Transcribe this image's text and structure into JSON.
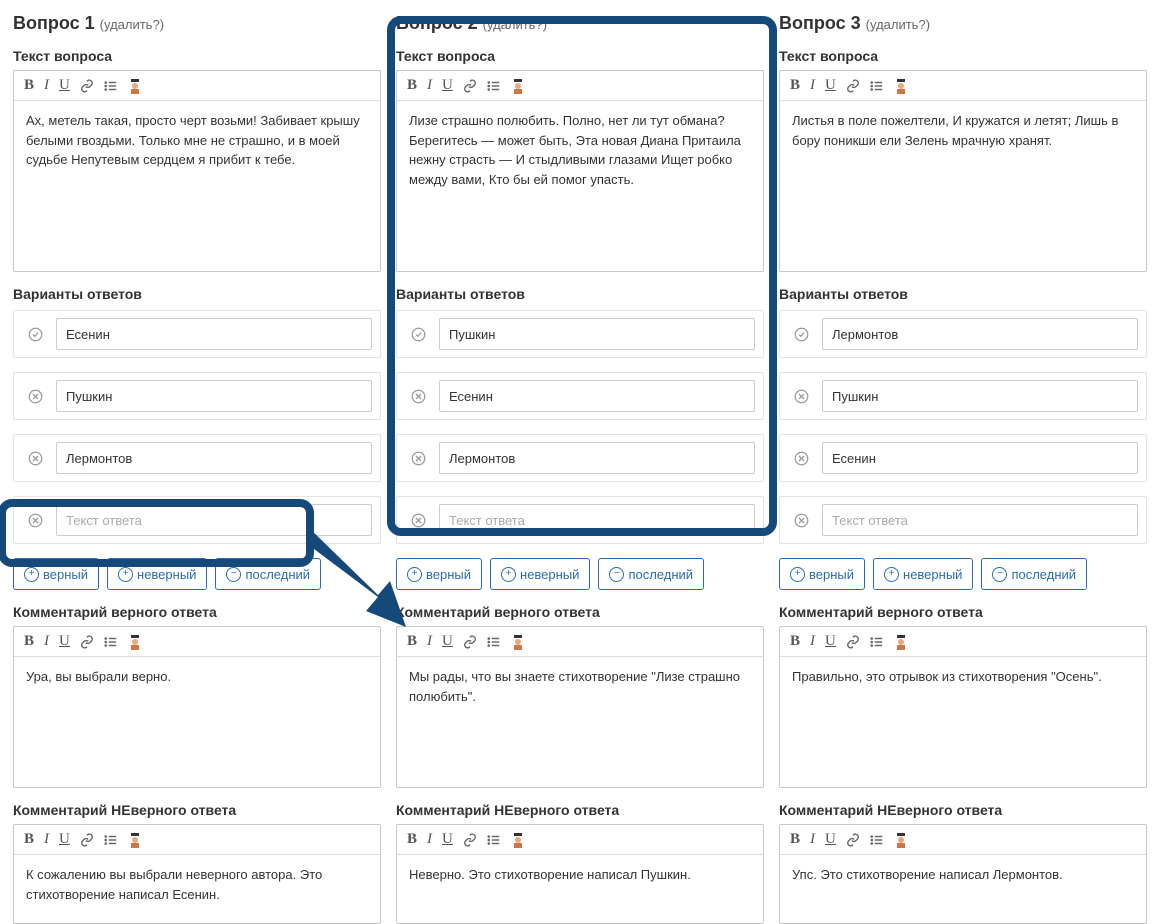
{
  "labels": {
    "delete": "(удалить?)",
    "question_text": "Текст вопроса",
    "answer_variants": "Варианты ответов",
    "answer_placeholder": "Текст ответа",
    "btn_correct": "верный",
    "btn_incorrect": "неверный",
    "btn_last": "последний",
    "comment_correct": "Комментарий верного ответа",
    "comment_incorrect": "Комментарий НЕверного ответа"
  },
  "toolbar": {
    "bold": "B",
    "italic": "I",
    "underline": "U",
    "link": "link",
    "list": "list",
    "avatar": "avatar"
  },
  "questions": [
    {
      "title": "Вопрос 1",
      "body": "Ах, метель такая, просто черт возьми! Забивает крышу белыми гвоздьми. Только мне не страшно, и в моей судьбе Непутевым сердцем я прибит к тебе.",
      "answers": [
        {
          "correct": true,
          "text": "Есенин"
        },
        {
          "correct": false,
          "text": "Пушкин"
        },
        {
          "correct": false,
          "text": "Лермонтов"
        },
        {
          "correct": false,
          "text": ""
        }
      ],
      "comment_correct": "Ура, вы выбрали верно.",
      "comment_incorrect": "К сожалению вы выбрали неверного автора. Это стихотворение написал Есенин."
    },
    {
      "title": "Вопрос 2",
      "body": "Лизе страшно полюбить. Полно, нет ли тут обмана? Берегитесь — может быть, Эта новая Диана Притаила нежну страсть — И стыдливыми глазами Ищет робко между вами, Кто бы ей помог упасть.",
      "answers": [
        {
          "correct": true,
          "text": "Пушкин"
        },
        {
          "correct": false,
          "text": "Есенин"
        },
        {
          "correct": false,
          "text": "Лермонтов"
        },
        {
          "correct": false,
          "text": ""
        }
      ],
      "comment_correct": "Мы рады, что вы знаете стихотворение \"Лизе страшно полюбить\".",
      "comment_incorrect": "Неверно. Это стихотворение написал Пушкин."
    },
    {
      "title": "Вопрос 3",
      "body": "Листья в поле пожелтели, И кружатся и летят; Лишь в бору поникши ели Зелень мрачную хранят.",
      "answers": [
        {
          "correct": true,
          "text": "Лермонтов"
        },
        {
          "correct": false,
          "text": "Пушкин"
        },
        {
          "correct": false,
          "text": "Есенин"
        },
        {
          "correct": false,
          "text": ""
        }
      ],
      "comment_correct": "Правильно, это отрывок из стихотворения \"Осень\".",
      "comment_incorrect": "Упс. Это стихотворение написал Лермонтов."
    }
  ]
}
